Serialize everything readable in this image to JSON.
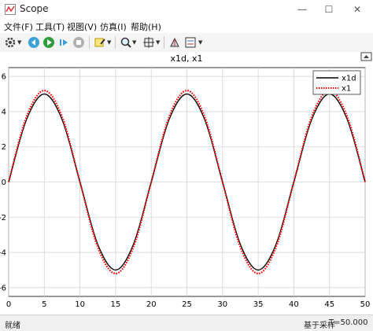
{
  "window": {
    "title": "Scope",
    "minimize": "—",
    "maximize": "☐",
    "close": "✕"
  },
  "menu": [
    "文件(F)",
    "工具(T)",
    "视图(V)",
    "仿真(I)",
    "帮助(H)"
  ],
  "toolbar": {
    "icons": [
      "settings-icon",
      "step-back-icon",
      "run-icon",
      "step-forward-icon",
      "stop-icon",
      "highlight-icon",
      "zoom-icon",
      "autoscale-icon",
      "cursor-measure-icon",
      "legend-icon"
    ]
  },
  "status": {
    "left": "就绪",
    "mid": "基于采样",
    "time": "T=50.000"
  },
  "chart_data": {
    "type": "line",
    "title": "x1d, x1",
    "xlim": [
      0,
      50
    ],
    "ylim": [
      -6.5,
      6.5
    ],
    "xticks": [
      0,
      5,
      10,
      15,
      20,
      25,
      30,
      35,
      40,
      45,
      50
    ],
    "yticks": [
      -6,
      -4,
      -2,
      0,
      2,
      4,
      6
    ],
    "grid": true,
    "legend_position": "top-right",
    "series": [
      {
        "name": "x1d",
        "color": "#000000",
        "style": "solid",
        "x": [
          0,
          2.5,
          5,
          7.5,
          10,
          12.5,
          15,
          17.5,
          20,
          22.5,
          25,
          27.5,
          30,
          32.5,
          35,
          37.5,
          40,
          42.5,
          45,
          47.5,
          50
        ],
        "y": [
          0,
          3.54,
          5,
          3.54,
          0,
          -3.54,
          -5,
          -3.54,
          0,
          3.54,
          5,
          3.54,
          0,
          -3.54,
          -5,
          -3.54,
          0,
          3.54,
          5,
          3.54,
          0
        ]
      },
      {
        "name": "x1",
        "color": "#ff0000",
        "style": "dotted",
        "x": [
          0,
          2.5,
          5,
          7.5,
          10,
          12.5,
          15,
          17.5,
          20,
          22.5,
          25,
          27.5,
          30,
          32.5,
          35,
          37.5,
          40,
          42.5,
          45,
          47.5,
          50
        ],
        "y": [
          0,
          3.7,
          5.2,
          3.7,
          0,
          -3.7,
          -5.2,
          -3.7,
          0,
          3.7,
          5.2,
          3.7,
          0,
          -3.7,
          -5.2,
          -3.7,
          0,
          3.7,
          5.2,
          3.7,
          0
        ]
      }
    ]
  }
}
